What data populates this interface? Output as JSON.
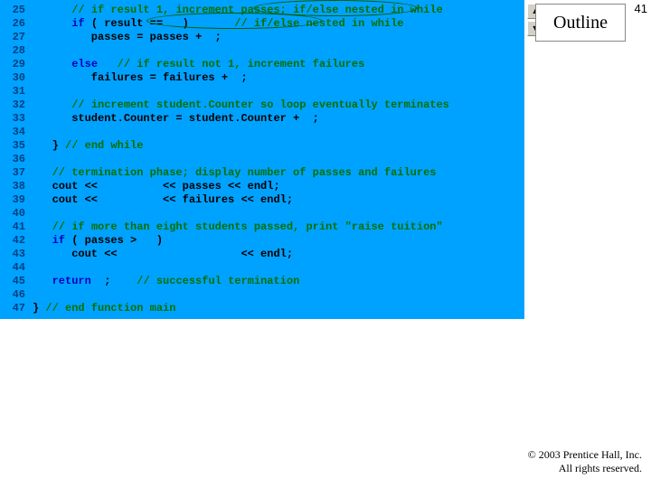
{
  "slide_number": "41",
  "outline_label": "Outline",
  "footer_line1": "© 2003 Prentice Hall, Inc.",
  "footer_line2": "All rights reserved.",
  "lines": [
    {
      "n": "25",
      "seg": [
        {
          "c": "",
          "t": "      "
        },
        {
          "c": "cm",
          "t": "// if result 1, increment passes; "
        },
        {
          "c": "cm",
          "t": "if/else nested in while"
        }
      ]
    },
    {
      "n": "26",
      "seg": [
        {
          "c": "",
          "t": "      "
        },
        {
          "c": "kw",
          "t": "if"
        },
        {
          "c": "",
          "t": " ( result ==   )       "
        },
        {
          "c": "cm",
          "t": "// if/else nested in while"
        }
      ]
    },
    {
      "n": "27",
      "seg": [
        {
          "c": "",
          "t": "         passes = passes +  ;"
        }
      ]
    },
    {
      "n": "28",
      "seg": [
        {
          "c": "",
          "t": ""
        }
      ]
    },
    {
      "n": "29",
      "seg": [
        {
          "c": "",
          "t": "      "
        },
        {
          "c": "kw",
          "t": "else"
        },
        {
          "c": "",
          "t": "   "
        },
        {
          "c": "cm",
          "t": "// if result not 1, increment failures"
        }
      ]
    },
    {
      "n": "30",
      "seg": [
        {
          "c": "",
          "t": "         failures = failures +  ;"
        }
      ]
    },
    {
      "n": "31",
      "seg": [
        {
          "c": "",
          "t": ""
        }
      ]
    },
    {
      "n": "32",
      "seg": [
        {
          "c": "",
          "t": "      "
        },
        {
          "c": "cm",
          "t": "// increment student.Counter so loop eventually terminates"
        }
      ]
    },
    {
      "n": "33",
      "seg": [
        {
          "c": "",
          "t": "      student.Counter = student.Counter +  ;"
        }
      ]
    },
    {
      "n": "34",
      "seg": [
        {
          "c": "",
          "t": ""
        }
      ]
    },
    {
      "n": "35",
      "seg": [
        {
          "c": "",
          "t": "   } "
        },
        {
          "c": "cm",
          "t": "// end while"
        }
      ]
    },
    {
      "n": "36",
      "seg": [
        {
          "c": "",
          "t": ""
        }
      ]
    },
    {
      "n": "37",
      "seg": [
        {
          "c": "",
          "t": "   "
        },
        {
          "c": "cm",
          "t": "// termination phase; display number of passes and failures"
        }
      ]
    },
    {
      "n": "38",
      "seg": [
        {
          "c": "",
          "t": "   cout <<          << passes << endl;"
        }
      ]
    },
    {
      "n": "39",
      "seg": [
        {
          "c": "",
          "t": "   cout <<          << failures << endl;"
        }
      ]
    },
    {
      "n": "40",
      "seg": [
        {
          "c": "",
          "t": ""
        }
      ]
    },
    {
      "n": "41",
      "seg": [
        {
          "c": "",
          "t": "   "
        },
        {
          "c": "cm",
          "t": "// if more than eight students passed, print \"raise tuition\""
        }
      ]
    },
    {
      "n": "42",
      "seg": [
        {
          "c": "",
          "t": "   "
        },
        {
          "c": "kw",
          "t": "if"
        },
        {
          "c": "",
          "t": " ( passes >   )"
        }
      ]
    },
    {
      "n": "43",
      "seg": [
        {
          "c": "",
          "t": "      cout <<                   << endl;"
        }
      ]
    },
    {
      "n": "44",
      "seg": [
        {
          "c": "",
          "t": ""
        }
      ]
    },
    {
      "n": "45",
      "seg": [
        {
          "c": "",
          "t": "   "
        },
        {
          "c": "kw",
          "t": "return"
        },
        {
          "c": "",
          "t": "  ;    "
        },
        {
          "c": "cm",
          "t": "// successful termination"
        }
      ]
    },
    {
      "n": "46",
      "seg": [
        {
          "c": "",
          "t": ""
        }
      ]
    },
    {
      "n": "47",
      "seg": [
        {
          "c": "",
          "t": "} "
        },
        {
          "c": "cm",
          "t": "// end function main"
        }
      ]
    }
  ]
}
